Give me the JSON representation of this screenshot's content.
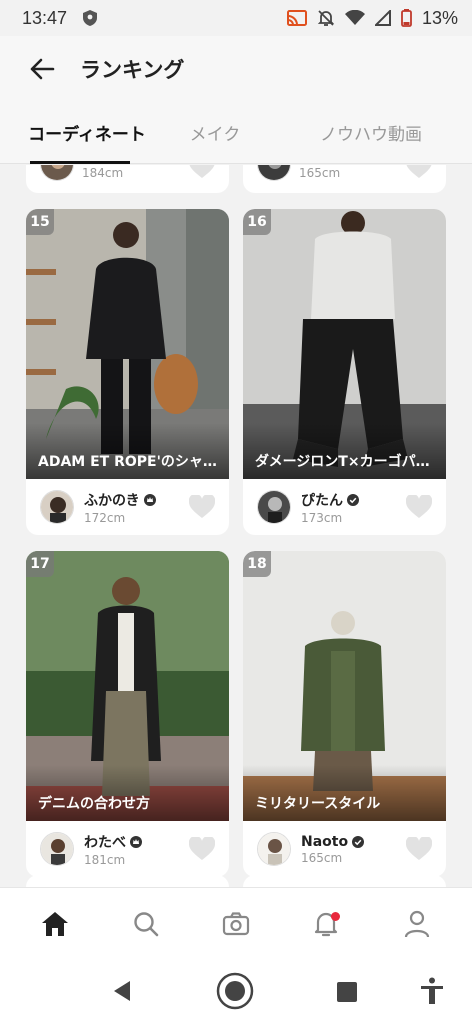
{
  "status_bar": {
    "time": "13:47",
    "battery": "13%",
    "icons": [
      "shield-icon",
      "cast-icon",
      "mute-icon",
      "wifi-icon",
      "signal-icon",
      "battery-icon"
    ]
  },
  "header": {
    "title": "ランキング",
    "back_icon": "arrow-left-icon"
  },
  "tabs": [
    {
      "label": "コーディネート",
      "active": true
    },
    {
      "label": "メイク",
      "active": false
    },
    {
      "label": "ノウハウ動画",
      "active": false
    }
  ],
  "partial_cards": [
    {
      "height": "184cm"
    },
    {
      "height": "165cm"
    }
  ],
  "cards": [
    {
      "rank": "15",
      "caption": "ADAM ET ROPE'のシャツ…",
      "user": "ふかのき",
      "badge": "crown-badge-icon",
      "height": "172cm"
    },
    {
      "rank": "16",
      "caption": "ダメージロンT×カーゴパ…",
      "user": "ぴたん",
      "badge": "verified-badge-icon",
      "height": "173cm"
    },
    {
      "rank": "17",
      "caption": "デニムの合わせ方",
      "user": "わたべ",
      "badge": "crown-badge-icon",
      "height": "181cm"
    },
    {
      "rank": "18",
      "caption": "ミリタリースタイル",
      "user": "Naoto",
      "badge": "verified-badge-icon",
      "height": "165cm"
    }
  ],
  "bottom_nav": [
    {
      "icon": "home-icon",
      "active": true
    },
    {
      "icon": "search-icon",
      "active": false
    },
    {
      "icon": "camera-icon",
      "active": false
    },
    {
      "icon": "bell-icon",
      "active": false,
      "has_notification": true
    },
    {
      "icon": "profile-icon",
      "active": false
    }
  ],
  "system_nav": [
    "back-triangle-icon",
    "home-circle-icon",
    "recents-square-icon",
    "accessibility-icon"
  ],
  "colors": {
    "accent": "#111111",
    "notification": "#e8283c",
    "inactive": "#999999"
  }
}
